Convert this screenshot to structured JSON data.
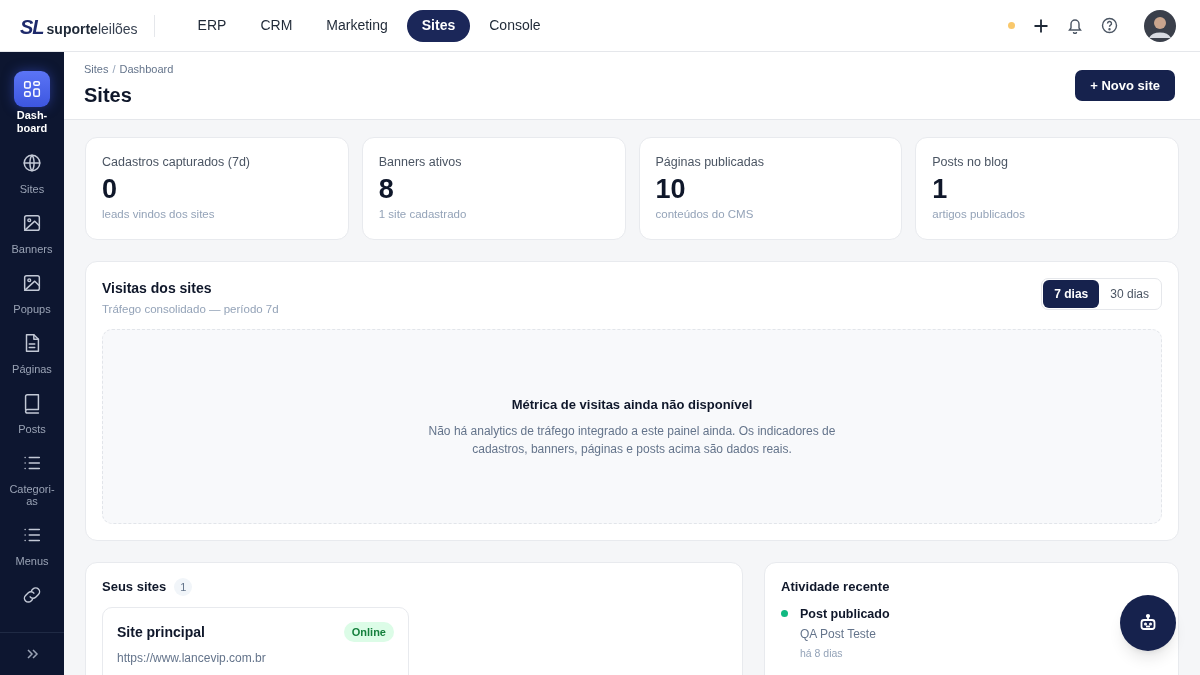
{
  "logo": {
    "mark": "SL",
    "brand_bold": "suporte",
    "brand_light": "leilões"
  },
  "top_nav": [
    {
      "label": "ERP",
      "selected": false
    },
    {
      "label": "CRM",
      "selected": false
    },
    {
      "label": "Marketing",
      "selected": false
    },
    {
      "label": "Sites",
      "selected": true
    },
    {
      "label": "Console",
      "selected": false
    }
  ],
  "sidebar": {
    "items": [
      {
        "label": "Dash-\nboard",
        "selected": true
      },
      {
        "label": "Sites",
        "selected": false
      },
      {
        "label": "Banners",
        "selected": false
      },
      {
        "label": "Popups",
        "selected": false
      },
      {
        "label": "Páginas",
        "selected": false
      },
      {
        "label": "Posts",
        "selected": false
      },
      {
        "label": "Categori-\nas",
        "selected": false
      },
      {
        "label": "Menus",
        "selected": false
      },
      {
        "selected": false
      }
    ]
  },
  "breadcrumb": [
    "Sites",
    "Dashboard"
  ],
  "breadcrumb_separator": "/",
  "page_title": "Sites",
  "primary_button": "+ Novo site",
  "stats": [
    {
      "label": "Cadastros capturados (7d)",
      "value": "0",
      "note": "leads vindos dos sites"
    },
    {
      "label": "Banners ativos",
      "value": "8",
      "note": "1 site cadastrado"
    },
    {
      "label": "Páginas publicadas",
      "value": "10",
      "note": "conteúdos do CMS"
    },
    {
      "label": "Posts no blog",
      "value": "1",
      "note": "artigos publicados"
    }
  ],
  "visits": {
    "title": "Visitas dos sites",
    "subtitle": "Tráfego consolidado — período 7d",
    "ranges": [
      {
        "label": "7 dias",
        "selected": true
      },
      {
        "label": "30 dias",
        "selected": false
      }
    ],
    "empty_title": "Métrica de visitas ainda não disponível",
    "empty_text": "Não há analytics de tráfego integrado a este painel ainda. Os indicadores de cadastros, banners, páginas e posts acima são dados reais."
  },
  "sites": {
    "title": "Seus sites",
    "count": "1",
    "items": [
      {
        "name": "Site principal",
        "status": "Online",
        "url": "https://www.lancevip.com.br"
      }
    ]
  },
  "activity": {
    "title": "Atividade recente",
    "items": [
      {
        "title": "Post publicado",
        "detail": "QA Post Teste",
        "time": "há 8 dias",
        "color": "#10b981"
      }
    ]
  }
}
